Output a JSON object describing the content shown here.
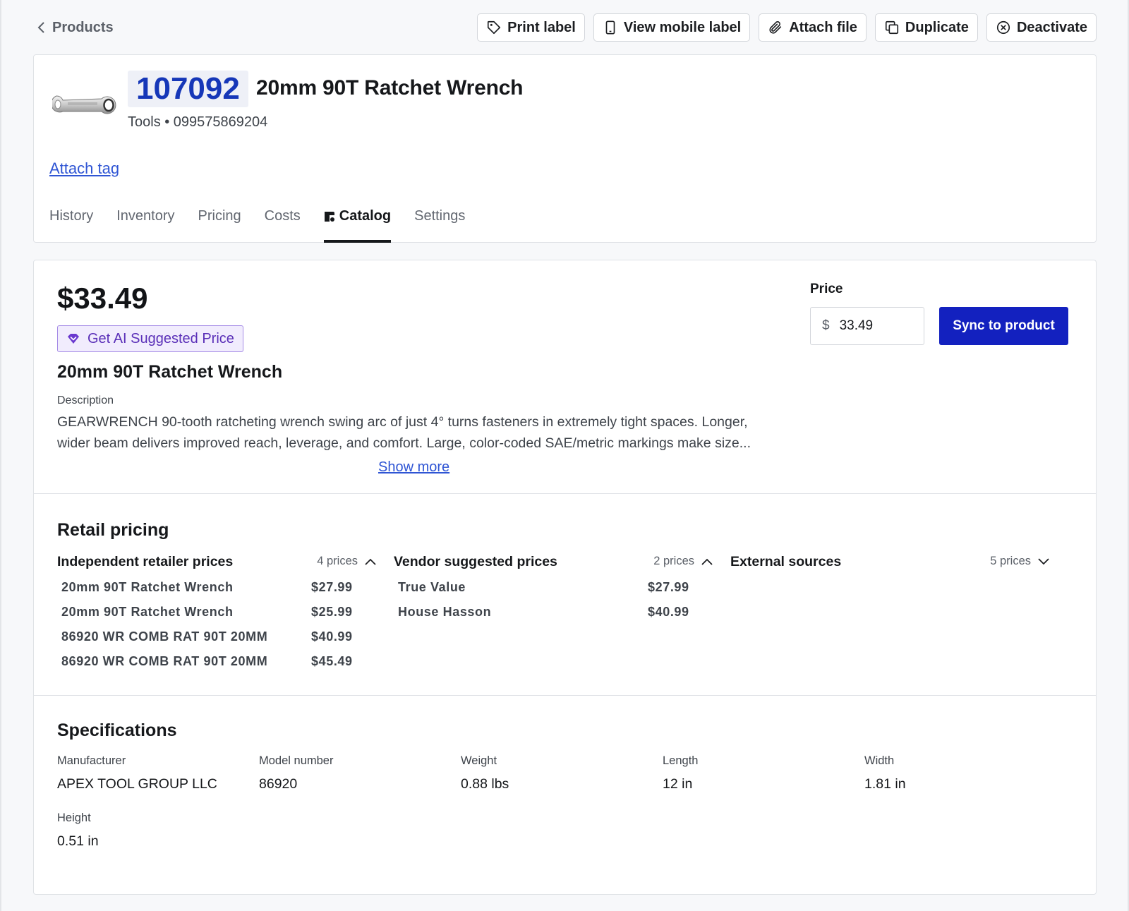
{
  "topbar": {
    "back_label": "Products",
    "actions": [
      {
        "label": "Print label",
        "icon": "tag-icon"
      },
      {
        "label": "View mobile label",
        "icon": "mobile-icon"
      },
      {
        "label": "Attach file",
        "icon": "paperclip-icon"
      },
      {
        "label": "Duplicate",
        "icon": "duplicate-icon"
      },
      {
        "label": "Deactivate",
        "icon": "circle-x-icon"
      }
    ]
  },
  "product": {
    "sku": "107092",
    "title": "20mm 90T Ratchet Wrench",
    "meta": "Tools • 099575869204",
    "attach_tag": "Attach tag"
  },
  "tabs": [
    {
      "label": "History",
      "active": false
    },
    {
      "label": "Inventory",
      "active": false
    },
    {
      "label": "Pricing",
      "active": false
    },
    {
      "label": "Costs",
      "active": false
    },
    {
      "label": "Catalog",
      "active": true
    },
    {
      "label": "Settings",
      "active": false
    }
  ],
  "catalog": {
    "price_display": "$33.49",
    "ai_button": "Get AI Suggested Price",
    "title": "20mm 90T Ratchet Wrench",
    "description_label": "Description",
    "description": "GEARWRENCH 90-tooth ratcheting wrench swing arc of just 4° turns fasteners in extremely tight spaces. Longer, wider beam delivers improved reach, leverage, and comfort. Large, color-coded SAE/metric markings make size...",
    "show_more": "Show more",
    "price_label": "Price",
    "currency": "$",
    "price_value": "33.49",
    "sync_button": "Sync to product"
  },
  "retail": {
    "title": "Retail pricing",
    "columns": [
      {
        "heading": "Independent retailer prices",
        "count": "4 prices",
        "expanded": true,
        "rows": [
          {
            "name": "20mm 90T Ratchet Wrench",
            "price": "$27.99"
          },
          {
            "name": "20mm 90T Ratchet Wrench",
            "price": "$25.99"
          },
          {
            "name": "86920 WR COMB RAT 90T 20MM",
            "price": "$40.99"
          },
          {
            "name": "86920 WR COMB RAT 90T 20MM",
            "price": "$45.49"
          }
        ]
      },
      {
        "heading": "Vendor suggested prices",
        "count": "2 prices",
        "expanded": true,
        "rows": [
          {
            "name": "True Value",
            "price": "$27.99"
          },
          {
            "name": "House Hasson",
            "price": "$40.99"
          }
        ]
      },
      {
        "heading": "External sources",
        "count": "5 prices",
        "expanded": false,
        "rows": []
      }
    ]
  },
  "specs": {
    "title": "Specifications",
    "items": [
      {
        "label": "Manufacturer",
        "value": "APEX TOOL GROUP LLC"
      },
      {
        "label": "Model number",
        "value": "86920"
      },
      {
        "label": "Weight",
        "value": "0.88 lbs"
      },
      {
        "label": "Length",
        "value": "12 in"
      },
      {
        "label": "Width",
        "value": "1.81 in"
      },
      {
        "label": "Height",
        "value": "0.51 in"
      }
    ]
  },
  "colors": {
    "accent": "#1321bf",
    "sku_text": "#1637b8",
    "link": "#2f55d4",
    "ai_purple": "#5a2fb8"
  }
}
